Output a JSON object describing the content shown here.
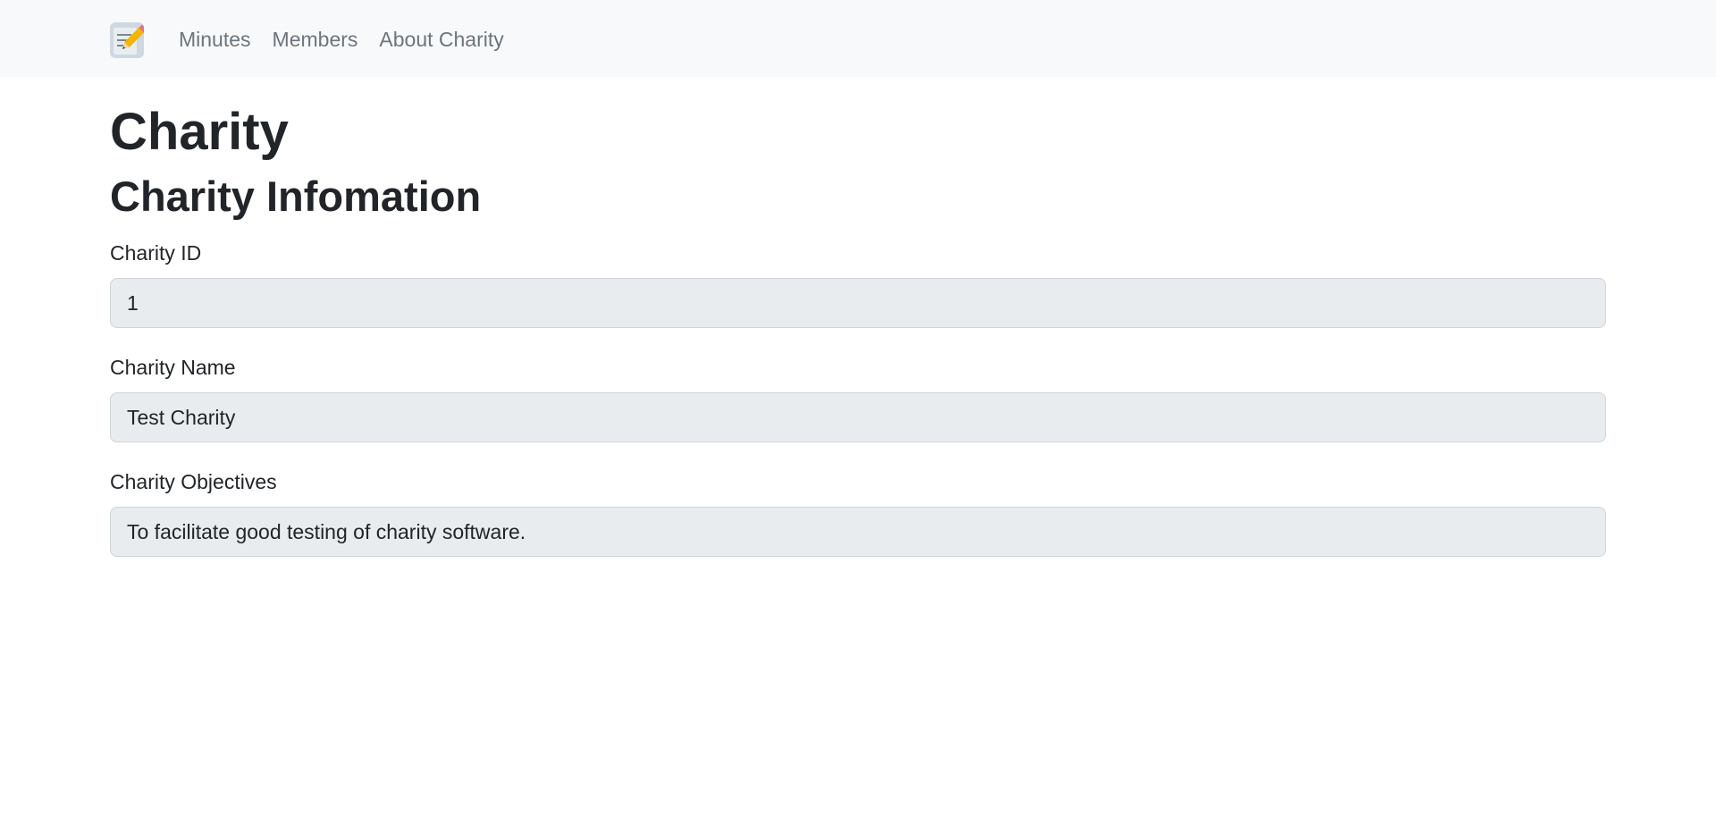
{
  "nav": {
    "brand_icon": "memo-pencil-icon",
    "links": [
      "Minutes",
      "Members",
      "About Charity"
    ]
  },
  "page": {
    "title": "Charity",
    "section_title": "Charity Infomation"
  },
  "fields": {
    "charity_id": {
      "label": "Charity ID",
      "value": "1"
    },
    "charity_name": {
      "label": "Charity Name",
      "value": "Test Charity"
    },
    "charity_objectives": {
      "label": "Charity Objectives",
      "value": "To facilitate good testing of charity software."
    }
  },
  "colors": {
    "navbar_bg": "#f8f9fa",
    "nav_link": "#6c757d",
    "input_bg": "#e9ecef",
    "input_border": "#ced4da",
    "text": "#212529"
  }
}
